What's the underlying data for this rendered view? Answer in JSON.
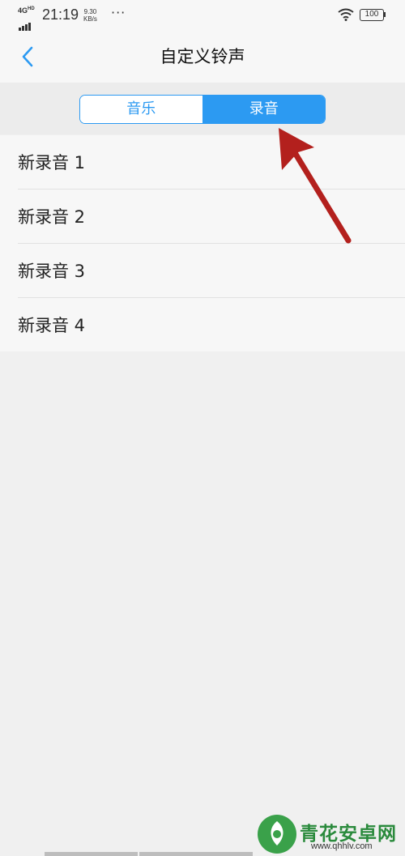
{
  "status_bar": {
    "network": "4G",
    "network_sup": "HD",
    "time": "21:19",
    "speed_value": "9.30",
    "speed_unit": "KB/s",
    "more": "···",
    "battery": "100"
  },
  "header": {
    "title": "自定义铃声"
  },
  "tabs": [
    {
      "label": "音乐",
      "selected": false
    },
    {
      "label": "录音",
      "selected": true
    }
  ],
  "recordings": [
    {
      "label": "新录音 1"
    },
    {
      "label": "新录音 2"
    },
    {
      "label": "新录音 3"
    },
    {
      "label": "新录音 4"
    }
  ],
  "watermark": {
    "text": "青花安卓网",
    "url": "www.qhhlv.com"
  },
  "colors": {
    "accent": "#2c9af2",
    "annotation_arrow": "#b3201d",
    "watermark_green": "#2a8a3c"
  },
  "icons": {
    "back": "chevron-left-icon",
    "wifi": "wifi-icon",
    "battery": "battery-icon",
    "signal": "signal-icon"
  }
}
